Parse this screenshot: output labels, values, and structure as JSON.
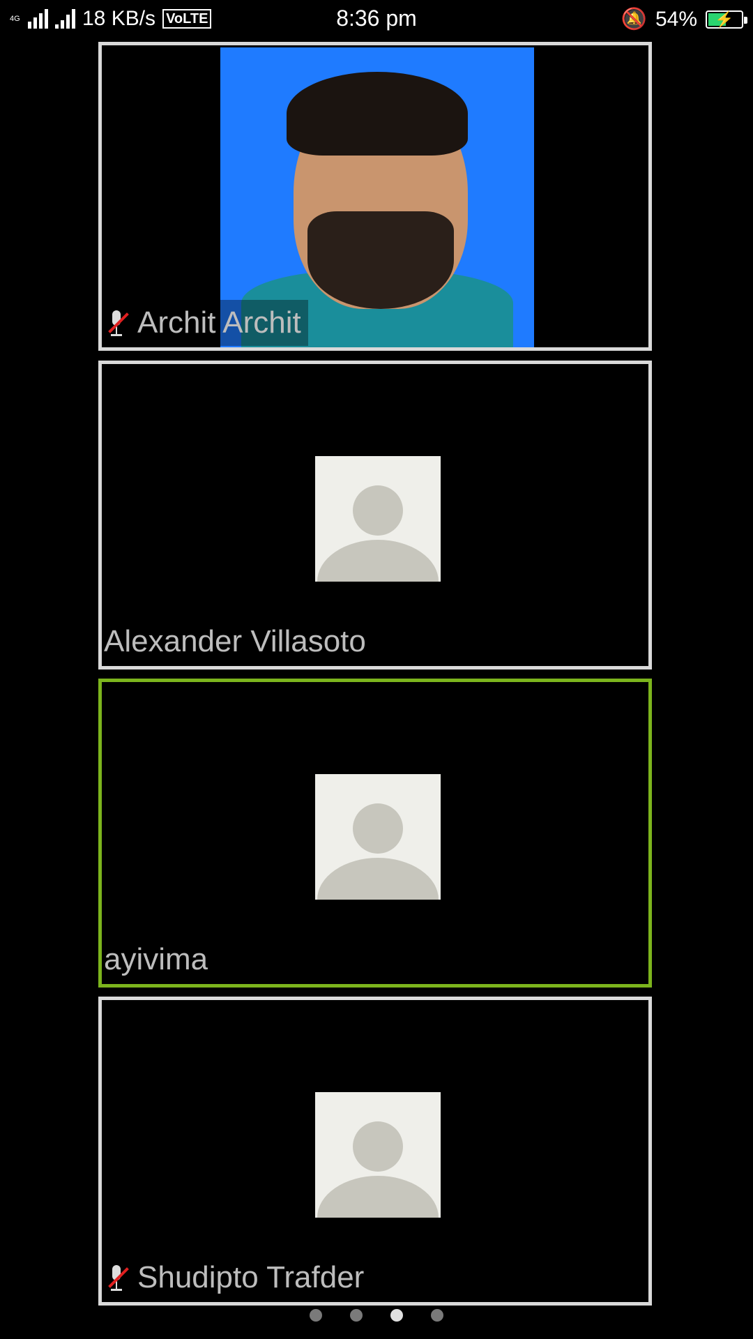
{
  "status_bar": {
    "network_small": "4G",
    "speed": "18 KB/s",
    "volte": "VoLTE",
    "time": "8:36 pm",
    "battery": "54%",
    "battery_level": 0.54
  },
  "participants": [
    {
      "name": "Archit Archit",
      "muted": true,
      "has_video": true,
      "active": false
    },
    {
      "name": "Alexander Villasoto",
      "muted": false,
      "has_video": false,
      "active": false
    },
    {
      "name": "ayivima",
      "muted": false,
      "has_video": false,
      "active": true
    },
    {
      "name": "Shudipto Trafder",
      "muted": true,
      "has_video": false,
      "active": false
    }
  ],
  "pager": {
    "count": 4,
    "current_index": 2
  },
  "colors": {
    "active_border": "#7cb41d",
    "tile_border": "#d9d9d9",
    "video_bg": "#1f7bff",
    "muted_slash": "#e02020"
  },
  "icons": [
    "signal-icon",
    "mute-icon",
    "battery-charging-icon",
    "avatar-placeholder-icon"
  ]
}
